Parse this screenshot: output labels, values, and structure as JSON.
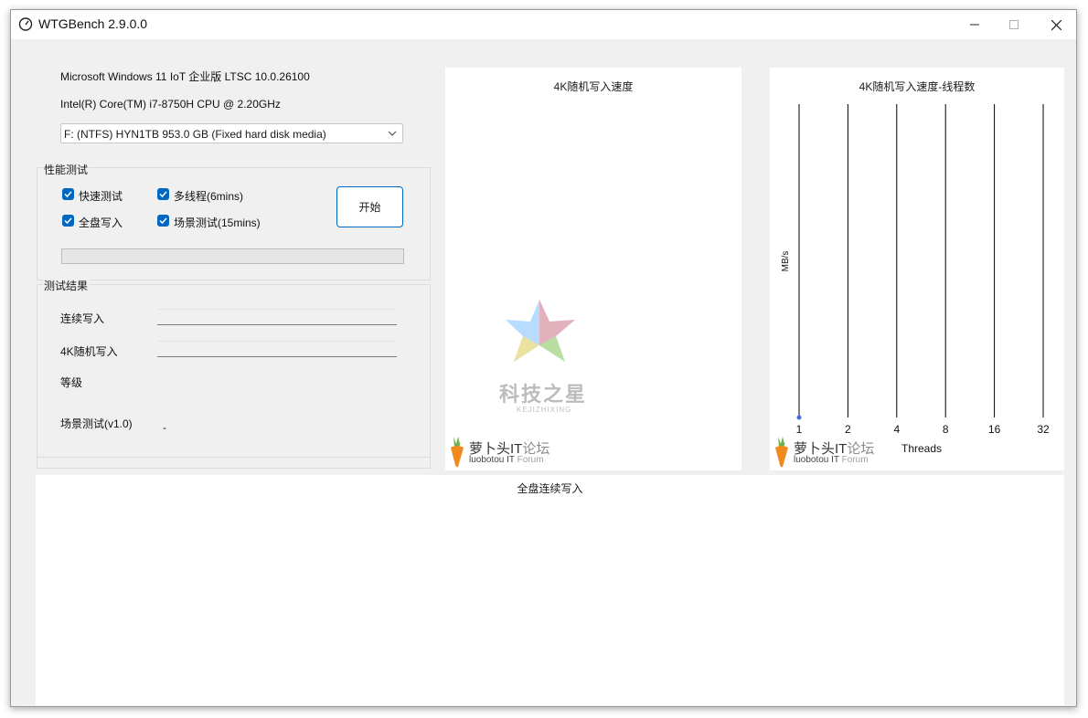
{
  "window": {
    "title": "WTGBench 2.9.0.0"
  },
  "system": {
    "os": "Microsoft Windows 11 IoT 企业版 LTSC 10.0.26100",
    "cpu": "Intel(R) Core(TM) i7-8750H CPU @ 2.20GHz"
  },
  "disk_select": {
    "value": "F:  (NTFS) HYN1TB 953.0 GB (Fixed hard disk media)"
  },
  "perf_test": {
    "title": "性能测试",
    "options": [
      {
        "label": "快速测试",
        "checked": true
      },
      {
        "label": "多线程(6mins)",
        "checked": true
      },
      {
        "label": "全盘写入",
        "checked": true
      },
      {
        "label": "场景测试(15mins)",
        "checked": true
      }
    ],
    "start_label": "开始",
    "progress": 0
  },
  "results": {
    "title": "测试结果",
    "seq_write": "连续写入",
    "rand4k_write": "4K随机写入",
    "grade": "等级",
    "scenario": "场景测试(v1.0)",
    "scenario_value": "-"
  },
  "watermarks": {
    "forum_cn_main": "萝卜头IT",
    "forum_cn_accent": "论坛",
    "forum_en_main": "luobotou IT",
    "forum_en_accent": " Forum",
    "star_cn": "科技之星",
    "star_en": "KEJIZHIXING"
  },
  "chart_data": [
    {
      "type": "line",
      "title": "4K随机写入速度",
      "series": []
    },
    {
      "type": "line",
      "title": "4K随机写入速度-线程数",
      "xlabel": "Threads",
      "ylabel": "MB/s",
      "categories": [
        "1",
        "2",
        "4",
        "8",
        "16",
        "32"
      ],
      "series": [
        {
          "values": [
            0
          ]
        }
      ],
      "grid": true
    },
    {
      "type": "line",
      "title": "全盘连续写入",
      "series": []
    }
  ],
  "colors": {
    "accent": "#0067c0",
    "chart_point": "#4169e1"
  }
}
